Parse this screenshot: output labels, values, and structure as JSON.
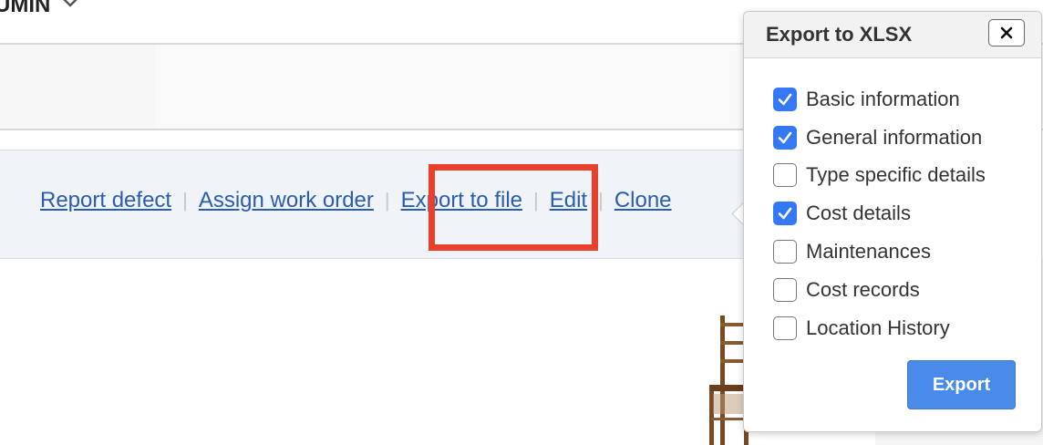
{
  "header": {
    "user_label": "UMIN"
  },
  "actions": [
    {
      "label": "Report defect"
    },
    {
      "label": "Assign work order"
    },
    {
      "label": "Export to file"
    },
    {
      "label": "Edit"
    },
    {
      "label": "Clone"
    }
  ],
  "popup": {
    "title": "Export to XLSX",
    "close_icon": "close-icon",
    "options": [
      {
        "label": "Basic information",
        "checked": true
      },
      {
        "label": "General information",
        "checked": true
      },
      {
        "label": "Type specific details",
        "checked": false
      },
      {
        "label": "Cost details",
        "checked": true
      },
      {
        "label": "Maintenances",
        "checked": false
      },
      {
        "label": "Cost records",
        "checked": false
      },
      {
        "label": "Location History",
        "checked": false
      }
    ],
    "export_label": "Export"
  },
  "colors": {
    "link": "#2a5db0",
    "highlight_border": "#e9402c",
    "checkbox_checked": "#3478f6",
    "export_button": "#4a8ae8"
  }
}
